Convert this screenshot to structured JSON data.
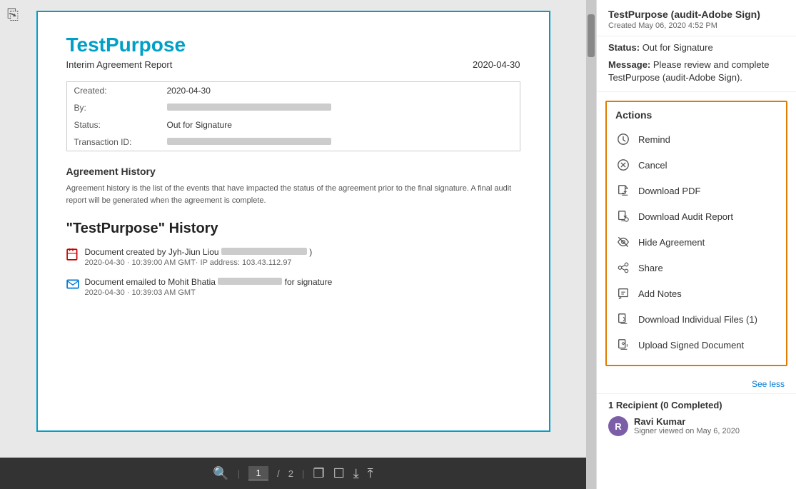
{
  "document": {
    "title": "TestPurpose",
    "subtitle": "Interim Agreement Report",
    "date": "2020-04-30",
    "meta": {
      "created_label": "Created:",
      "created_value": "2020-04-30",
      "by_label": "By:",
      "status_label": "Status:",
      "status_value": "Out for Signature",
      "transaction_label": "Transaction ID:"
    },
    "agreement_history": {
      "title": "Agreement History",
      "description": "Agreement history is the list of the events that have impacted the status of the agreement prior to the final signature. A final audit report will be generated when the agreement is complete."
    },
    "history_title": "\"TestPurpose\" History",
    "history_items": [
      {
        "text": "Document created by Jyh-Jiun Liou",
        "date": "2020-04-30 · 10:39:00 AM GMT· IP address: 103.43.112.97"
      },
      {
        "text": "Document emailed to Mohit Bhatia                    for signature",
        "date": "2020-04-30 · 10:39:03 AM GMT"
      }
    ]
  },
  "toolbar": {
    "page_current": "1",
    "page_separator": "/",
    "page_total": "2"
  },
  "right_panel": {
    "doc_name": "TestPurpose (audit-Adobe Sign)",
    "created_date": "Created May 06, 2020 4:52 PM",
    "status_label": "Status:",
    "status_value": "Out for Signature",
    "message_label": "Message:",
    "message_value": "Please review and complete TestPurpose (audit-Adobe Sign)."
  },
  "actions": {
    "title": "Actions",
    "items": [
      {
        "id": "remind",
        "label": "Remind",
        "icon": "clock"
      },
      {
        "id": "cancel",
        "label": "Cancel",
        "icon": "x-circle"
      },
      {
        "id": "download-pdf",
        "label": "Download PDF",
        "icon": "download-doc"
      },
      {
        "id": "download-audit",
        "label": "Download Audit Report",
        "icon": "download-audit"
      },
      {
        "id": "hide",
        "label": "Hide Agreement",
        "icon": "eye-off"
      },
      {
        "id": "share",
        "label": "Share",
        "icon": "share"
      },
      {
        "id": "notes",
        "label": "Add Notes",
        "icon": "notes"
      },
      {
        "id": "download-individual",
        "label": "Download Individual Files (1)",
        "icon": "download-file"
      },
      {
        "id": "upload-signed",
        "label": "Upload Signed Document",
        "icon": "upload"
      }
    ],
    "see_less": "See less"
  },
  "recipients": {
    "label": "1 Recipient (0 Completed)",
    "items": [
      {
        "name": "Ravi Kumar",
        "status": "Signer viewed on May 6, 2020",
        "avatar_initials": "R"
      }
    ]
  }
}
